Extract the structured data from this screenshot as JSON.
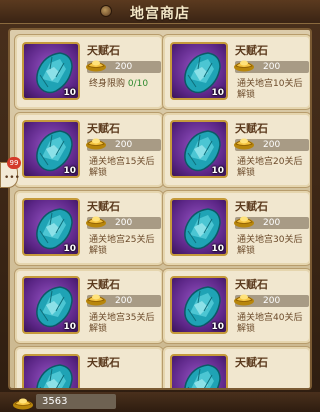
{
  "header": {
    "title": "地宫商店"
  },
  "items": [
    {
      "name": "天赋石",
      "price": "200",
      "qty": "10",
      "condition": "终身限购",
      "limit": "0/10"
    },
    {
      "name": "天赋石",
      "price": "200",
      "qty": "10",
      "condition": "通关地宫10关后解锁"
    },
    {
      "name": "天赋石",
      "price": "200",
      "qty": "10",
      "condition": "通关地宫15关后解锁"
    },
    {
      "name": "天赋石",
      "price": "200",
      "qty": "10",
      "condition": "通关地宫20关后解锁"
    },
    {
      "name": "天赋石",
      "price": "200",
      "qty": "10",
      "condition": "通关地宫25关后解锁"
    },
    {
      "name": "天赋石",
      "price": "200",
      "qty": "10",
      "condition": "通关地宫30关后解锁"
    },
    {
      "name": "天赋石",
      "price": "200",
      "qty": "10",
      "condition": "通关地宫35关后解锁"
    },
    {
      "name": "天赋石",
      "price": "200",
      "qty": "10",
      "condition": "通关地宫40关后解锁"
    },
    {
      "name": "天赋石",
      "price": "",
      "qty": "10",
      "condition": ""
    },
    {
      "name": "天赋石",
      "price": "",
      "qty": "10",
      "condition": ""
    }
  ],
  "side_badge": {
    "count": "99"
  },
  "footer": {
    "gold": "3563"
  },
  "colors": {
    "accent_gold": "#c59a3b",
    "gem_bg": "#5a2585",
    "limit_green": "#2e8b2e"
  },
  "icons": {
    "item": "talent-stone-icon",
    "currency": "gold-ingot-icon"
  }
}
